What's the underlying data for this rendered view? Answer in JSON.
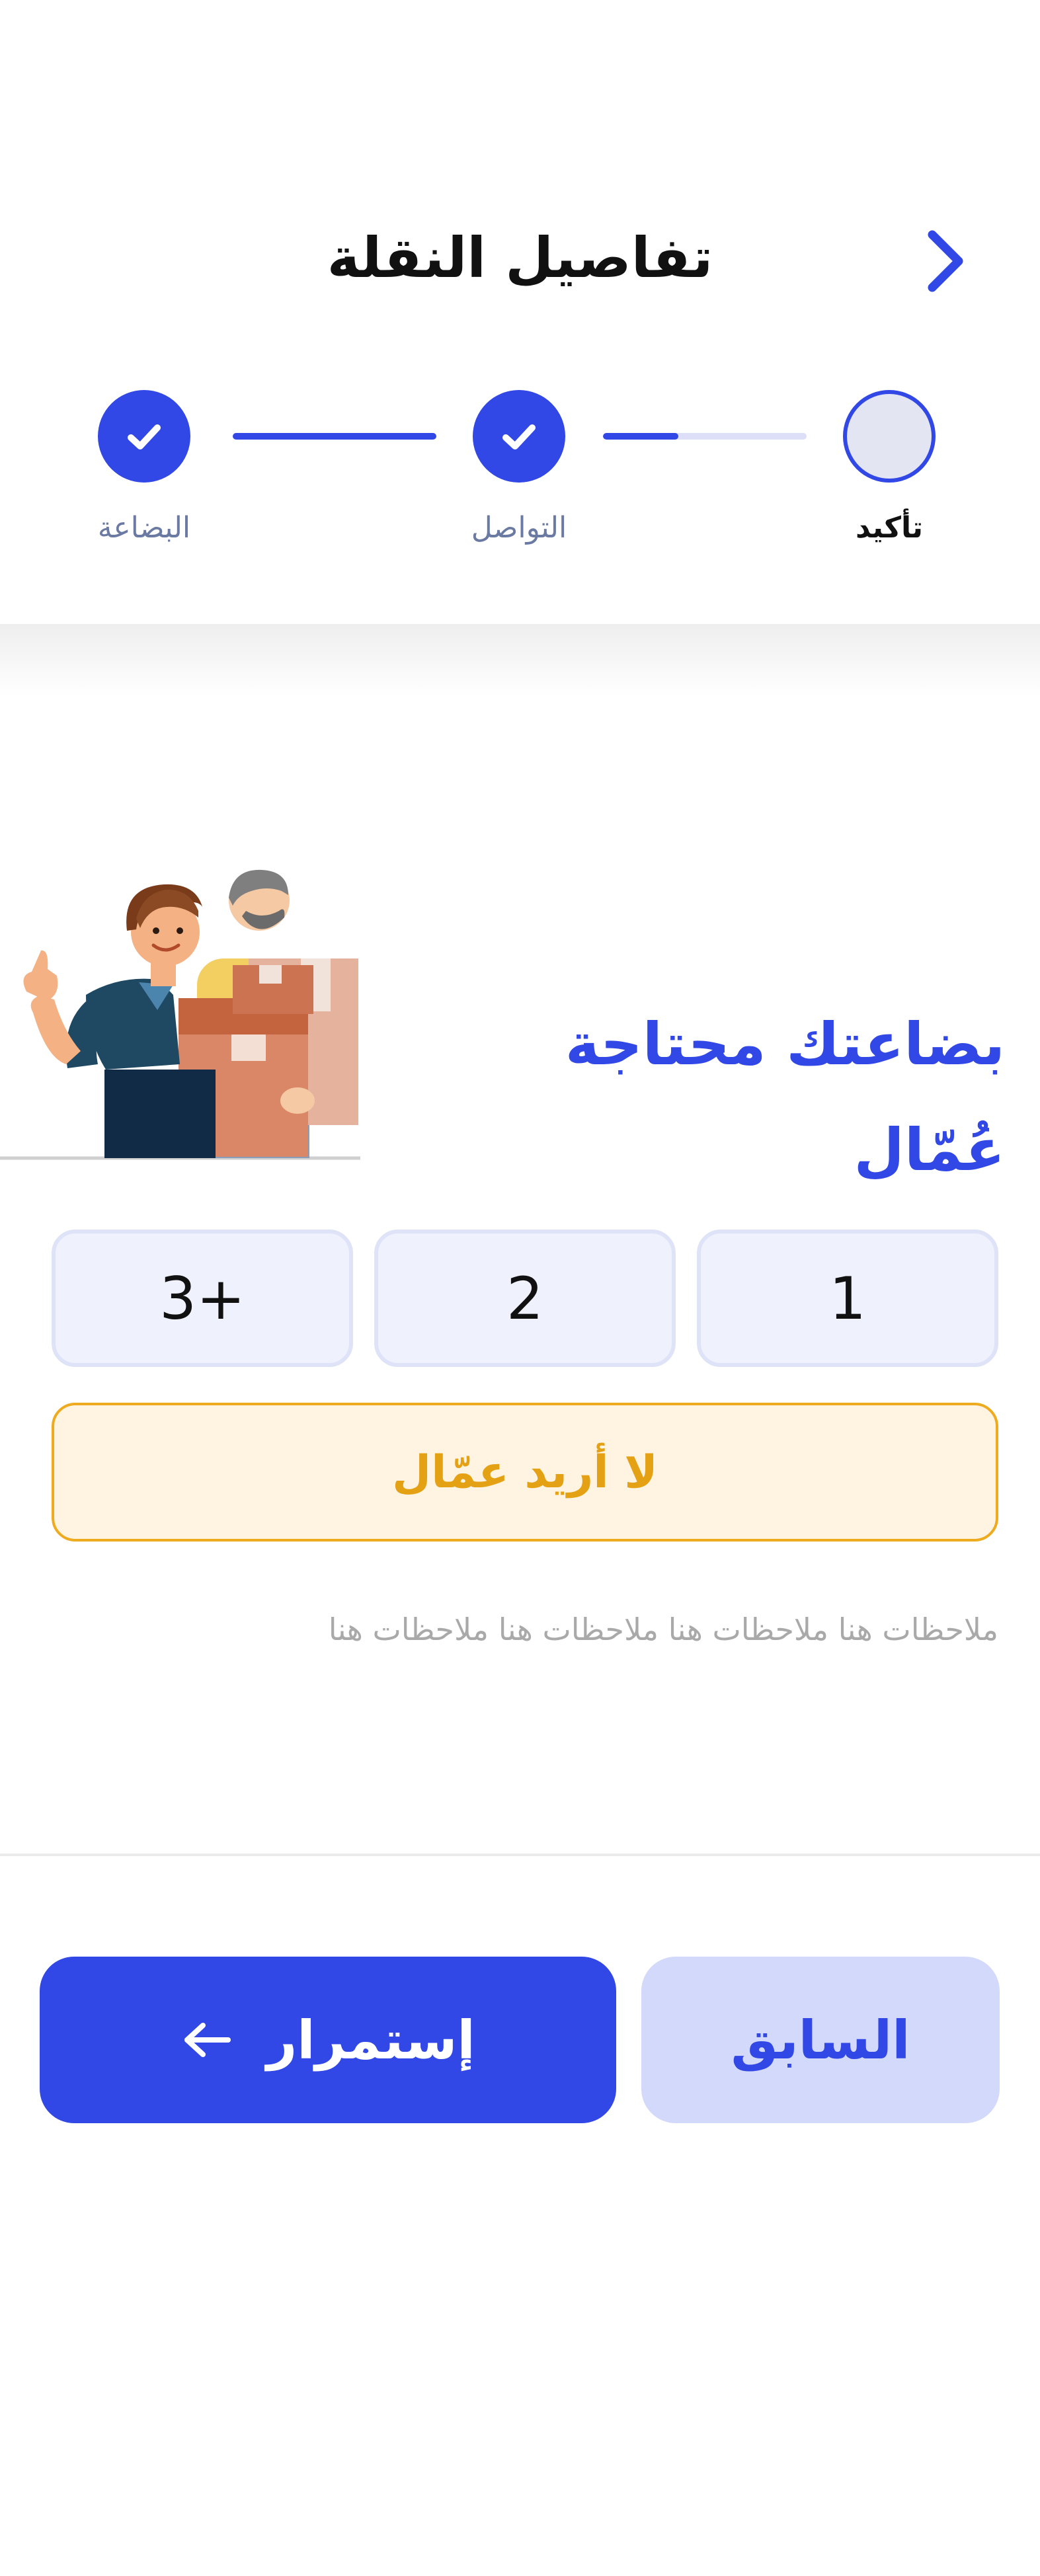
{
  "header": {
    "title": "تفاصيل النقلة",
    "back_icon": "chevron-right-icon"
  },
  "stepper": {
    "steps": [
      {
        "label": "البضاعة",
        "state": "done"
      },
      {
        "label": "التواصل",
        "state": "done"
      },
      {
        "label": "تأكيد",
        "state": "current"
      }
    ],
    "progress_second_connector": 0.37
  },
  "question": {
    "title": "بضاعتك محتاجة عُمّال"
  },
  "options": [
    {
      "label": "1"
    },
    {
      "label": "2"
    },
    {
      "label": "3+"
    }
  ],
  "no_workers_label": "لا أريد عمّال",
  "notes": "ملاحظات هنا ملاحظات هنا ملاحظات هنا ملاحظات هنا",
  "footer": {
    "previous_label": "السابق",
    "continue_label": "إستمرار",
    "continue_icon": "arrow-left-icon"
  },
  "colors": {
    "primary": "#3148e6",
    "primary_light": "#d3d9fb",
    "warning": "#efab1f",
    "warning_bg": "#fff3e2"
  }
}
